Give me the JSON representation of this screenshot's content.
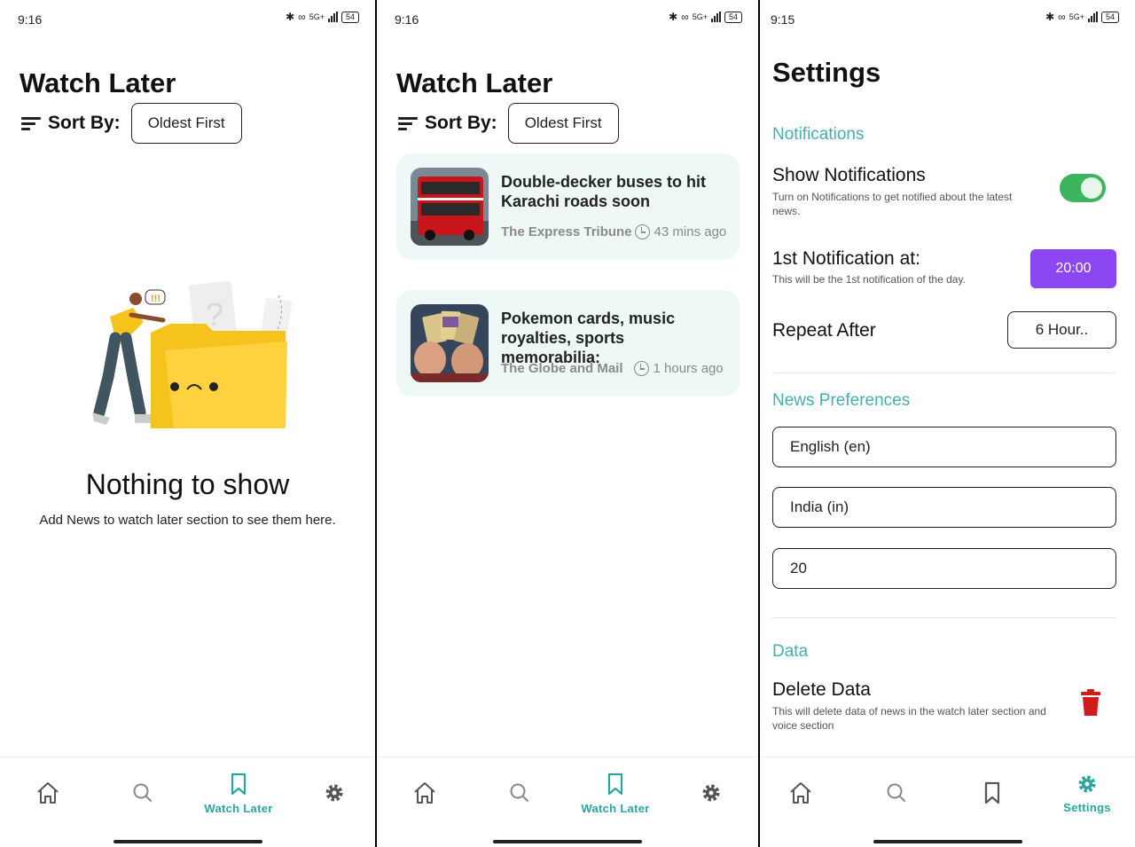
{
  "screen1": {
    "status": {
      "time": "9:16",
      "network": "5G+",
      "battery": "54"
    },
    "title": "Watch Later",
    "sort": {
      "label": "Sort By:",
      "value": "Oldest First"
    },
    "empty": {
      "title": "Nothing to show",
      "subtitle": "Add News to watch later section to see them here."
    },
    "nav": {
      "active_label": "Watch Later"
    }
  },
  "screen2": {
    "status": {
      "time": "9:16",
      "network": "5G+",
      "battery": "54"
    },
    "title": "Watch Later",
    "sort": {
      "label": "Sort By:",
      "value": "Oldest First"
    },
    "articles": [
      {
        "headline": "Double-decker buses to hit Karachi roads soon",
        "source": "The Express Tribune",
        "time": "43 mins ago"
      },
      {
        "headline": "Pokemon cards, music royalties, sports memorabilia:",
        "source": "The Globe and Mail",
        "time": "1 hours ago"
      }
    ],
    "nav": {
      "active_label": "Watch Later"
    }
  },
  "screen3": {
    "status": {
      "time": "9:15",
      "network": "5G+",
      "battery": "54"
    },
    "title": "Settings",
    "notifications": {
      "section": "Notifications",
      "show_title": "Show Notifications",
      "show_sub": "Turn on Notifications to get notified about the latest news.",
      "show_enabled": true,
      "first_title": "1st Notification at:",
      "first_sub": "This will be the 1st notification of the day.",
      "first_value": "20:00",
      "repeat_title": "Repeat After",
      "repeat_value": "6 Hour.."
    },
    "news_prefs": {
      "section": "News Preferences",
      "language": "English (en)",
      "country": "India (in)",
      "count": "20"
    },
    "data": {
      "section": "Data",
      "delete_title": "Delete Data",
      "delete_sub": "This will delete data of news in the watch later section and voice section"
    },
    "nav": {
      "active_label": "Settings"
    }
  },
  "colors": {
    "accent": "#2aa6a0",
    "toggle_on": "#3db55e",
    "time_button": "#8c47f2",
    "delete": "#d11a1a",
    "card_bg": "#eef8f6"
  },
  "icons": [
    "home-icon",
    "search-icon",
    "bookmark-icon",
    "gear-icon",
    "sort-icon",
    "clock-icon",
    "trash-icon"
  ]
}
